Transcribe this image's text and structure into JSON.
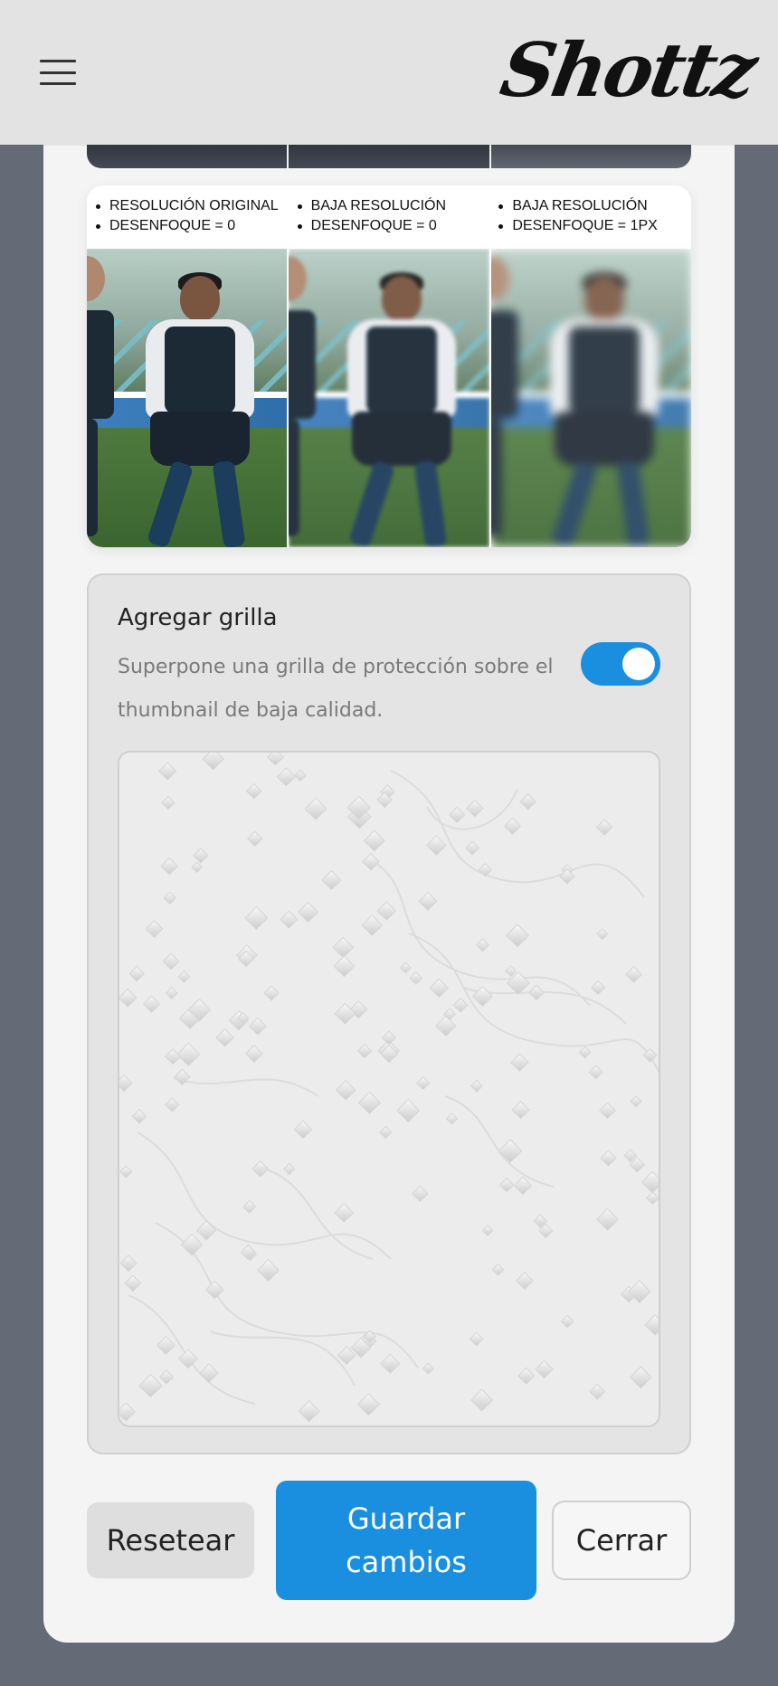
{
  "header": {
    "logo_text": "Shottz",
    "menu_icon": "hamburger-menu-icon"
  },
  "comparison": {
    "columns": [
      {
        "line1": "RESOLUCIÓN ORIGINAL",
        "line2": "DESENFOQUE = 0"
      },
      {
        "line1": "BAJA RESOLUCIÓN",
        "line2": "DESENFOQUE = 0"
      },
      {
        "line1": "BAJA RESOLUCIÓN",
        "line2": "DESENFOQUE = 1PX"
      }
    ]
  },
  "grid_option": {
    "title": "Agregar grilla",
    "description": "Superpone una grilla de protección sobre el thumbnail de baja calidad.",
    "enabled": true
  },
  "actions": {
    "reset_label": "Resetear",
    "save_label": "Guardar cambios",
    "close_label": "Cerrar"
  },
  "colors": {
    "accent": "#1a8fe0",
    "page_bg": "#646a76",
    "panel_bg": "#f4f4f4",
    "header_bg": "#e3e3e3"
  }
}
